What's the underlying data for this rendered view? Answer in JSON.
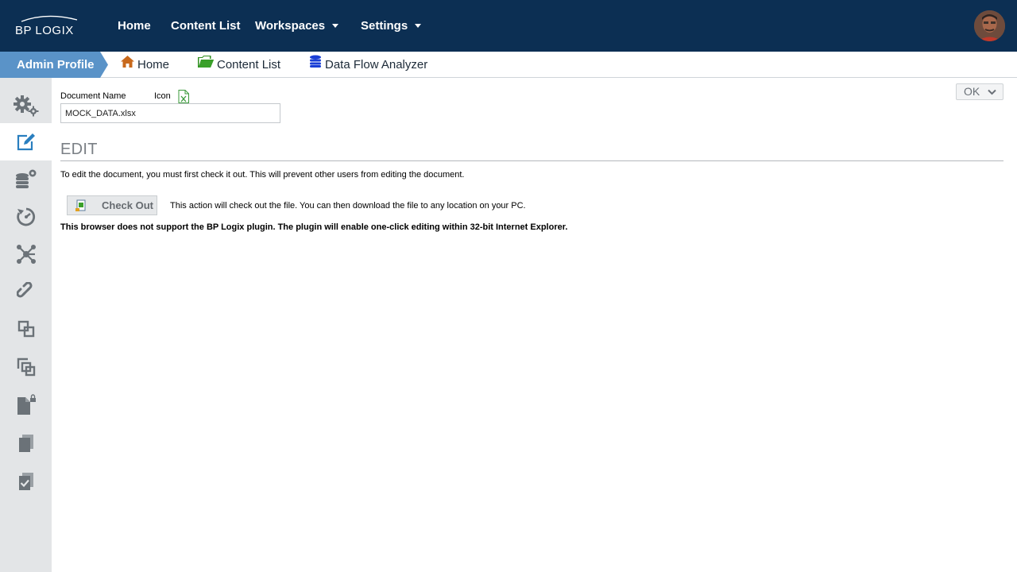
{
  "topbar": {
    "logo_text": "BP LOGIX",
    "nav": [
      {
        "label": "Home"
      },
      {
        "label": "Content List"
      },
      {
        "label": "Workspaces",
        "has_dropdown": true
      },
      {
        "label": "Settings",
        "has_dropdown": true
      }
    ],
    "avatar_icon": "user-avatar"
  },
  "breadcrumb": {
    "active": "Admin Profile",
    "items": [
      {
        "label": "Home",
        "icon": "home-icon",
        "color": "#c8691c"
      },
      {
        "label": "Content List",
        "icon": "folder-open-icon",
        "color": "#2f8f1f"
      },
      {
        "label": "Data Flow Analyzer",
        "icon": "database-stack-icon",
        "color": "#1a3fd6"
      }
    ]
  },
  "sidebar": {
    "items": [
      {
        "icon": "gears-icon",
        "active": false
      },
      {
        "icon": "edit-icon",
        "active": true
      },
      {
        "icon": "database-settings-icon",
        "active": false
      },
      {
        "icon": "history-icon",
        "active": false
      },
      {
        "icon": "workflow-network-icon",
        "active": false
      },
      {
        "icon": "link-icon",
        "active": false
      },
      {
        "icon": "copy-outline-icon",
        "active": false
      },
      {
        "icon": "clone-icon",
        "active": false
      },
      {
        "icon": "locked-document-icon",
        "active": false
      },
      {
        "icon": "documents-icon",
        "active": false
      },
      {
        "icon": "checked-documents-icon",
        "active": false
      }
    ]
  },
  "form": {
    "document_name_label": "Document Name",
    "icon_label": "Icon",
    "document_name_value": "MOCK_DATA.xlsx",
    "ok_label": "OK"
  },
  "edit": {
    "title": "EDIT",
    "instructions": "To edit the document, you must first check it out. This will prevent other users from editing the document.",
    "checkout_label": "Check Out",
    "checkout_description": "This action will check out the file. You can then download the file to any location on your PC.",
    "plugin_note": "This browser does not support the BP Logix plugin. The plugin will enable one-click editing within 32-bit Internet Explorer."
  },
  "colors": {
    "topbar_bg": "#0c2f53",
    "active_crumb_bg": "#5a93c8",
    "sidebar_bg": "#e3e5e7",
    "sidebar_icon": "#6b7278",
    "active_icon": "#2a7fbf"
  }
}
